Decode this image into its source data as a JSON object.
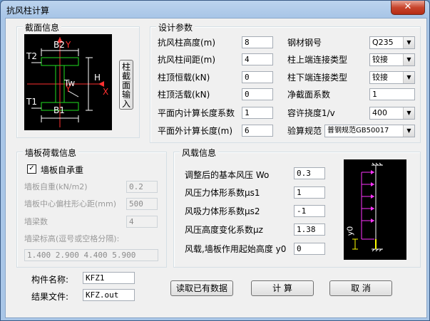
{
  "window": {
    "title": "抗风柱计算",
    "close_glyph": "✕"
  },
  "section": {
    "legend": "截面信息",
    "diagram_labels": {
      "b2": "B2",
      "y_top": "Y",
      "t2": "T2",
      "tw": "Tw",
      "h": "H",
      "x": "X",
      "t1": "T1",
      "b1": "B1",
      "y_bottom": "Y"
    },
    "input_button": "柱截面输入"
  },
  "design": {
    "legend": "设计参数",
    "column_height_label": "抗风柱高度(m)",
    "column_height": "8",
    "column_spacing_label": "抗风柱间距(m)",
    "column_spacing": "4",
    "top_dead_load_label": "柱顶恒载(kN)",
    "top_dead_load": "0",
    "top_live_load_label": "柱顶活载(kN)",
    "top_live_load": "0",
    "in_plane_coef_label": "平面内计算长度系数",
    "in_plane_coef": "1",
    "out_plane_length_label": "平面外计算长度(m)",
    "out_plane_length": "6",
    "steel_label": "钢材钢号",
    "steel": "Q235",
    "top_conn_label": "柱上端连接类型",
    "top_conn": "铰接",
    "bottom_conn_label": "柱下端连接类型",
    "bottom_conn": "铰接",
    "net_section_label": "净截面系数",
    "net_section": "1",
    "deflection_label": "容许挠度1/v",
    "deflection": "400",
    "code_label": "验算规范",
    "code": "普钢规范GB50017"
  },
  "wall": {
    "legend": "墙板荷载信息",
    "self_bearing_label": "墙板自承重",
    "self_bearing_checked": "✓",
    "weight_label": "墙板自重(kN/m2)",
    "weight": "0.2",
    "eccentric_label": "墙板中心偏柱形心距(mm)",
    "eccentric": "500",
    "beam_count_label": "墙梁数",
    "beam_count": "4",
    "beam_elev_label": "墙梁标高(逗号或空格分隔):",
    "beam_elev": "1.400 2.900 4.400 5.900"
  },
  "wind": {
    "legend": "风载信息",
    "pressure_label": "调整后的基本风压 Wo",
    "pressure": "0.3",
    "shape_pressure_label": "风压力体形系数μs1",
    "shape_pressure": "1",
    "shape_suction_label": "风吸力体形系数μs2",
    "shape_suction": "-1",
    "height_coef_label": "风压高度变化系数μz",
    "height_coef": "1.38",
    "start_height_label": "风载,墙板作用起始高度 y0",
    "start_height": "0",
    "diagram_y0": "y0"
  },
  "member": {
    "name_label": "构件名称:",
    "name": "KFZ1",
    "result_label": "结果文件:",
    "result": "KFZ.out"
  },
  "buttons": {
    "read": "读取已有数据",
    "calc": "计 算",
    "cancel": "取 消"
  }
}
